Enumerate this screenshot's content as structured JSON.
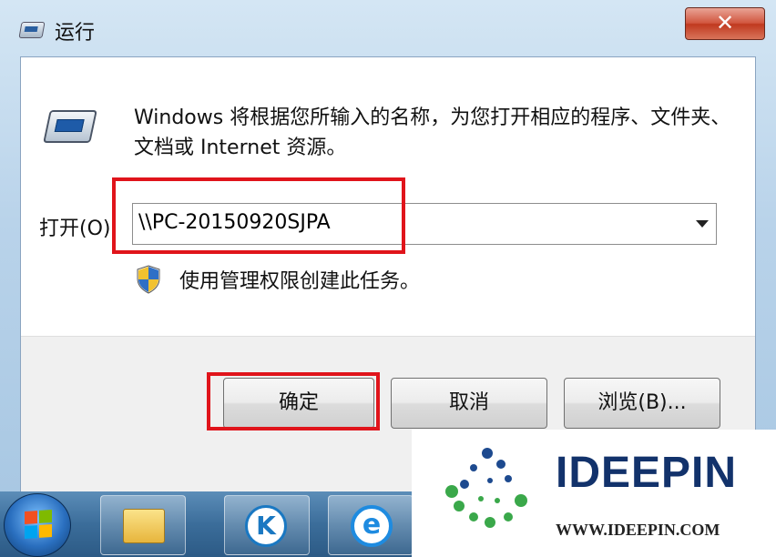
{
  "window": {
    "title": "运行",
    "close_label": "✕"
  },
  "dialog": {
    "description": "Windows 将根据您所输入的名称，为您打开相应的程序、文件夹、文档或 Internet 资源。",
    "open_label": "打开(O):",
    "open_value": "\\\\PC-20150920SJPA",
    "admin_text": "使用管理权限创建此任务。",
    "buttons": {
      "ok": "确定",
      "cancel": "取消",
      "browse": "浏览(B)..."
    }
  },
  "taskbar": {
    "k_label": "K",
    "ie_label": "e"
  },
  "watermark": {
    "brand": "IDEEPIN",
    "url": "WWW.IDEEPIN.COM"
  },
  "colors": {
    "highlight": "#e0141b",
    "brand": "#12326b"
  }
}
